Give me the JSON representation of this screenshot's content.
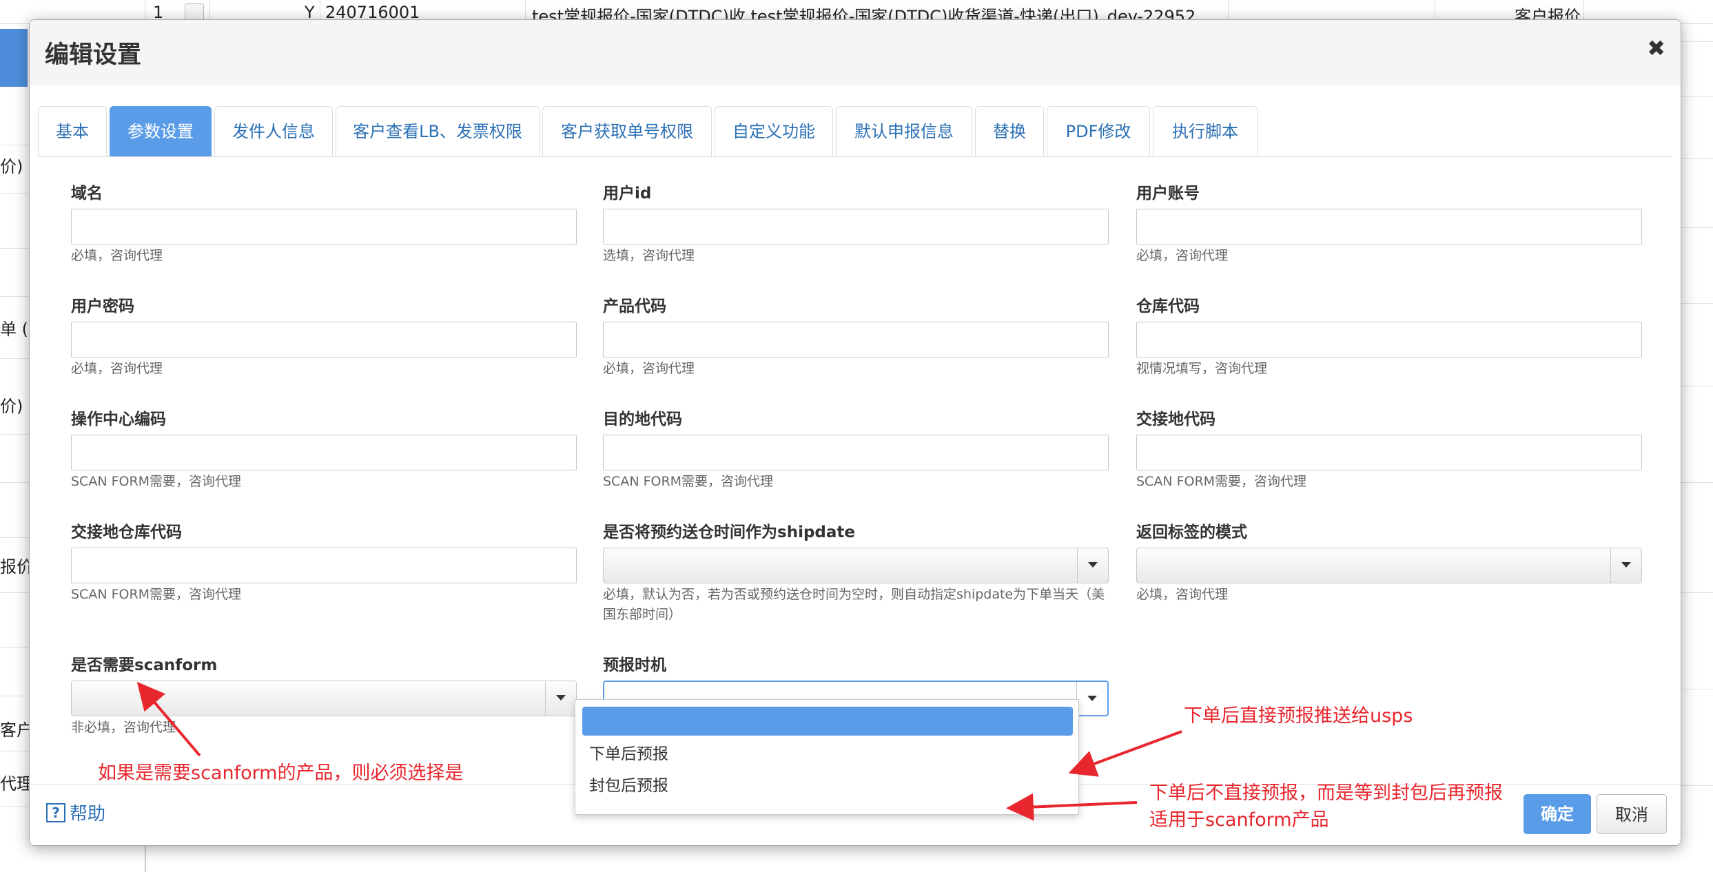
{
  "background": {
    "row_index": "1",
    "row_flag": "Y",
    "row_code": "240716001",
    "row_desc": "test常规报价-国家(DTDC)收 test常规报价-国家(DTDC)收货渠道-快递(出口)_dev-22952",
    "row_type": "客户报价",
    "left_fragments": [
      "价)",
      "单 ( 客",
      "价)",
      "报价",
      "客户",
      "代理/"
    ]
  },
  "modal": {
    "title": "编辑设置",
    "close_glyph": "✖",
    "tabs": [
      {
        "label": "基本"
      },
      {
        "label": "参数设置",
        "active": true
      },
      {
        "label": "发件人信息"
      },
      {
        "label": "客户查看LB、发票权限"
      },
      {
        "label": "客户获取单号权限"
      },
      {
        "label": "自定义功能"
      },
      {
        "label": "默认申报信息"
      },
      {
        "label": "替换"
      },
      {
        "label": "PDF修改"
      },
      {
        "label": "执行脚本"
      }
    ],
    "fields": {
      "domain": {
        "label": "域名",
        "help": "必填，咨询代理",
        "value": ""
      },
      "user_id": {
        "label": "用户id",
        "help": "选填，咨询代理",
        "value": ""
      },
      "user_account": {
        "label": "用户账号",
        "help": "必填，咨询代理",
        "value": ""
      },
      "user_password": {
        "label": "用户密码",
        "help": "必填，咨询代理",
        "value": ""
      },
      "product_code": {
        "label": "产品代码",
        "help": "必填，咨询代理",
        "value": ""
      },
      "warehouse_code": {
        "label": "仓库代码",
        "help": "视情况填写，咨询代理",
        "value": ""
      },
      "ops_center_code": {
        "label": "操作中心编码",
        "help": "SCAN FORM需要，咨询代理",
        "value": ""
      },
      "destination_code": {
        "label": "目的地代码",
        "help": "SCAN FORM需要，咨询代理",
        "value": ""
      },
      "handover_code": {
        "label": "交接地代码",
        "help": "SCAN FORM需要，咨询代理",
        "value": ""
      },
      "handover_wh_code": {
        "label": "交接地仓库代码",
        "help": "SCAN FORM需要，咨询代理",
        "value": ""
      },
      "shipdate_mode": {
        "label": "是否将预约送仓时间作为shipdate",
        "help": "必填，默认为否，若为否或预约送仓时间为空时，则自动指定shipdate为下单当天（美国东部时间）",
        "value": ""
      },
      "label_mode": {
        "label": "返回标签的模式",
        "help": "必填，咨询代理",
        "value": ""
      },
      "need_scanform": {
        "label": "是否需要scanform",
        "help": "非必填，咨询代理",
        "value": ""
      },
      "prealert_timing": {
        "label": "预报时机",
        "value": "",
        "options": [
          "",
          "下单后预报",
          "封包后预报"
        ]
      }
    },
    "footer": {
      "help": "帮助",
      "help_icon": "?",
      "ok": "确定",
      "cancel": "取消"
    }
  },
  "annotations": {
    "scanform": "如果是需要scanform的产品，则必须选择是",
    "after_order": "下单后直接预报推送给usps",
    "after_pack_1": "下单后不直接预报，而是等到封包后再预报",
    "after_pack_2": "适用于scanform产品",
    "color": "#e8262d"
  }
}
